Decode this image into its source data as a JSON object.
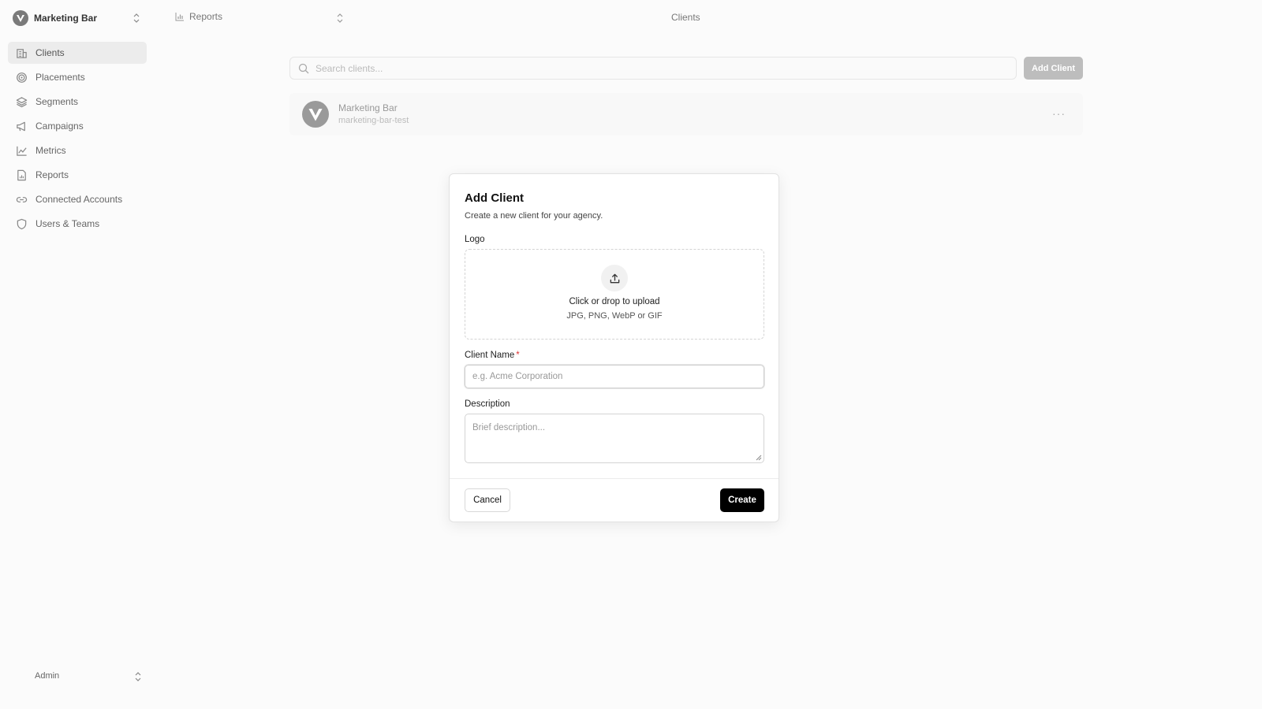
{
  "sidebar": {
    "org_name": "Marketing Bar",
    "items": [
      {
        "label": "Clients",
        "icon": "building-icon"
      },
      {
        "label": "Placements",
        "icon": "target-icon"
      },
      {
        "label": "Segments",
        "icon": "layers-icon"
      },
      {
        "label": "Campaigns",
        "icon": "megaphone-icon"
      },
      {
        "label": "Metrics",
        "icon": "line-chart-icon"
      },
      {
        "label": "Reports",
        "icon": "file-chart-icon"
      },
      {
        "label": "Connected Accounts",
        "icon": "link-icon"
      },
      {
        "label": "Users & Teams",
        "icon": "shield-icon"
      }
    ],
    "active_item": "Clients",
    "user_label": "Admin"
  },
  "header": {
    "report_selector": "Reports",
    "page_title": "Clients"
  },
  "clients_page": {
    "search_placeholder": "Search clients...",
    "add_button": "Add Client",
    "clients": [
      {
        "name": "Marketing Bar",
        "slug": "marketing-bar-test",
        "more": "···"
      }
    ]
  },
  "modal": {
    "title": "Add Client",
    "subtitle": "Create a new client for your agency.",
    "logo_label": "Logo",
    "upload_text": "Click or drop to upload",
    "upload_hint": "JPG, PNG, WebP or GIF",
    "name_label": "Client Name",
    "name_required": "*",
    "name_placeholder": "e.g. Acme Corporation",
    "description_label": "Description",
    "description_placeholder": "Brief description...",
    "cancel_label": "Cancel",
    "create_label": "Create"
  },
  "colors": {
    "primary_button": "#000000",
    "required_marker": "#dd3333",
    "active_nav_bg": "#ececec"
  }
}
